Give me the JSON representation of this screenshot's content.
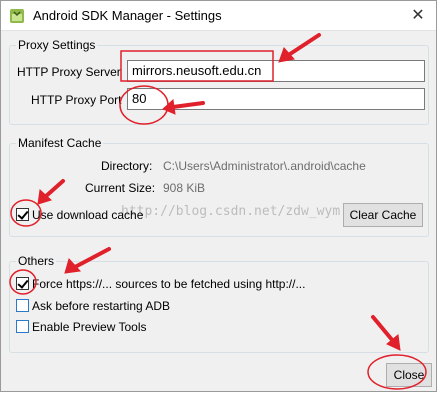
{
  "window": {
    "title": "Android SDK Manager - Settings",
    "close_glyph": "✕"
  },
  "proxy": {
    "group_label": "Proxy Settings",
    "server_label": "HTTP Proxy Server",
    "server_value": "mirrors.neusoft.edu.cn",
    "port_label": "HTTP Proxy Port",
    "port_value": "80"
  },
  "cache": {
    "group_label": "Manifest Cache",
    "directory_label": "Directory:",
    "directory_value": "C:\\Users\\Administrator\\.android\\cache",
    "size_label": "Current Size:",
    "size_value": "908 KiB",
    "use_cache_label": "Use download cache",
    "use_cache_checked": true,
    "clear_button": "Clear Cache"
  },
  "others": {
    "group_label": "Others",
    "options": [
      {
        "label": "Force https://... sources to be fetched using http://...",
        "checked": true
      },
      {
        "label": "Ask before restarting ADB",
        "checked": false
      },
      {
        "label": "Enable Preview Tools",
        "checked": false
      }
    ]
  },
  "close_button": "Close",
  "watermark": "http://blog.csdn.net/zdw_wym",
  "annotation_color": "#e0202a"
}
